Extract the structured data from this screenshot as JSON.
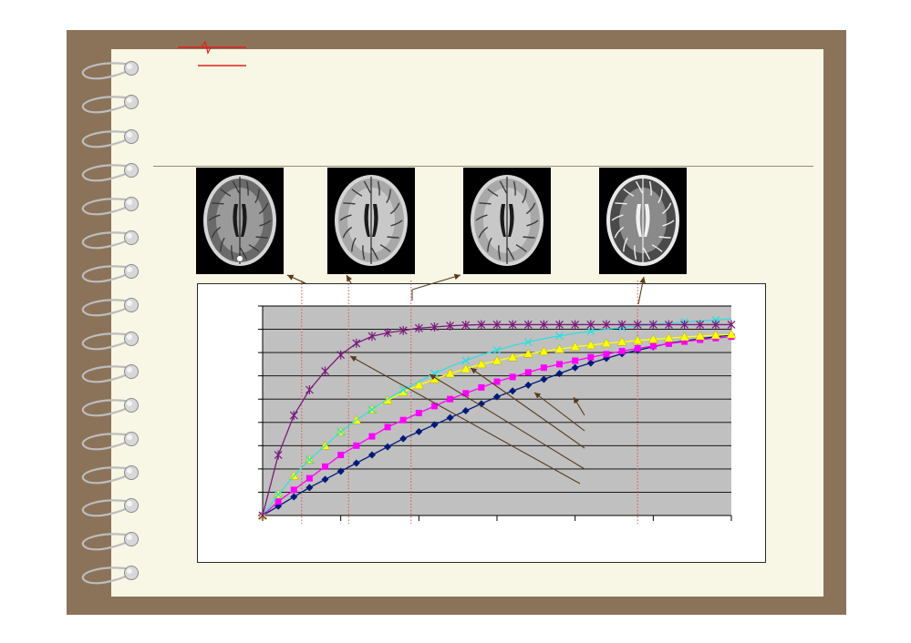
{
  "slide": {
    "background_color": "#ffffff",
    "frame_color": "#8b735a",
    "paper_color": "#f8f6e4",
    "accent_color": "#e0201c",
    "title": ""
  },
  "images": [
    {
      "name": "brain-scan-1",
      "description_icon": "mri-axial-t1-icon"
    },
    {
      "name": "brain-scan-2",
      "description_icon": "mri-axial-pd-icon"
    },
    {
      "name": "brain-scan-3",
      "description_icon": "mri-axial-pd-icon"
    },
    {
      "name": "brain-scan-4",
      "description_icon": "mri-axial-t2-icon"
    }
  ],
  "chart_data": {
    "type": "line",
    "title": "",
    "xlabel": "",
    "ylabel": "",
    "grid": true,
    "legend": "none",
    "plot_background": "#c0c0c0",
    "xlim": [
      0,
      30
    ],
    "ylim": [
      0,
      9
    ],
    "x": [
      0,
      1,
      2,
      3,
      4,
      5,
      6,
      7,
      8,
      9,
      10,
      11,
      12,
      13,
      14,
      15,
      16,
      17,
      18,
      19,
      20,
      21,
      22,
      23,
      24,
      25,
      26,
      27,
      28,
      29,
      30
    ],
    "series": [
      {
        "color": "#7b1a7b",
        "marker": "star",
        "values": [
          0,
          2.6,
          4.3,
          5.4,
          6.2,
          6.9,
          7.4,
          7.7,
          7.85,
          7.95,
          8.05,
          8.1,
          8.15,
          8.18,
          8.2,
          8.2,
          8.2,
          8.2,
          8.2,
          8.2,
          8.2,
          8.2,
          8.2,
          8.2,
          8.2,
          8.2,
          8.2,
          8.2,
          8.2,
          8.2,
          8.2
        ]
      },
      {
        "color": "#33dddd",
        "marker": "x",
        "values": [
          0,
          0.9,
          1.7,
          2.4,
          3.0,
          3.6,
          4.1,
          4.55,
          5.0,
          5.4,
          5.75,
          6.1,
          6.4,
          6.65,
          6.9,
          7.1,
          7.3,
          7.45,
          7.6,
          7.72,
          7.82,
          7.92,
          8.0,
          8.08,
          8.15,
          8.21,
          8.26,
          8.31,
          8.36,
          8.4,
          8.45
        ]
      },
      {
        "color": "#ffff00",
        "marker": "triangle",
        "values": [
          0,
          0.9,
          1.7,
          2.4,
          3.0,
          3.6,
          4.1,
          4.55,
          4.95,
          5.3,
          5.6,
          5.85,
          6.1,
          6.3,
          6.5,
          6.65,
          6.8,
          6.95,
          7.05,
          7.15,
          7.25,
          7.32,
          7.4,
          7.46,
          7.52,
          7.57,
          7.62,
          7.67,
          7.71,
          7.75,
          7.78
        ]
      },
      {
        "color": "#ff00ff",
        "marker": "square",
        "values": [
          0,
          0.6,
          1.1,
          1.6,
          2.1,
          2.6,
          3.0,
          3.4,
          3.8,
          4.1,
          4.4,
          4.7,
          5.0,
          5.25,
          5.5,
          5.75,
          5.95,
          6.15,
          6.35,
          6.5,
          6.65,
          6.8,
          6.93,
          7.06,
          7.18,
          7.28,
          7.38,
          7.47,
          7.55,
          7.62,
          7.68
        ]
      },
      {
        "color": "#001a7a",
        "marker": "diamond",
        "values": [
          0,
          0.4,
          0.8,
          1.2,
          1.55,
          1.9,
          2.25,
          2.6,
          2.95,
          3.3,
          3.6,
          3.9,
          4.2,
          4.5,
          4.8,
          5.1,
          5.35,
          5.6,
          5.85,
          6.1,
          6.35,
          6.55,
          6.75,
          6.95,
          7.1,
          7.25,
          7.4,
          7.5,
          7.6,
          7.68,
          7.75
        ]
      }
    ],
    "annotations": {
      "vertical_markers_x": [
        2.5,
        5.5,
        9.5,
        24.0
      ],
      "arrow_color": "#5a3a1a"
    }
  }
}
